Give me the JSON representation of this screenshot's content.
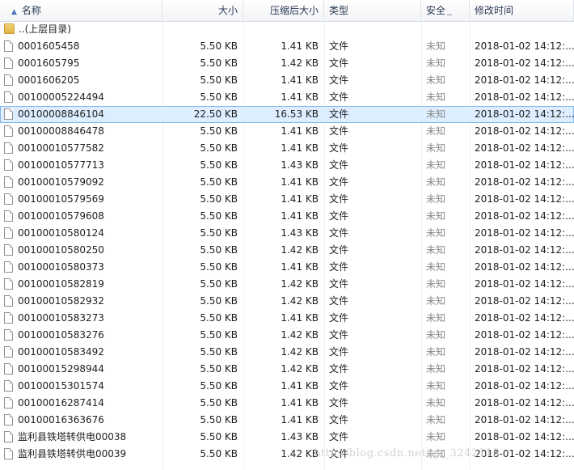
{
  "header": {
    "name": "名称",
    "size": "大小",
    "compressed": "压缩后大小",
    "type": "类型",
    "security": "安全",
    "modified": "修改时间"
  },
  "parent_label": "..(上层目录)",
  "rows": [
    {
      "name": "0001605458",
      "size": "5.50 KB",
      "comp": "1.41 KB",
      "type": "文件",
      "sec": "未知",
      "mod": "2018-01-02 14:12:..."
    },
    {
      "name": "0001605795",
      "size": "5.50 KB",
      "comp": "1.42 KB",
      "type": "文件",
      "sec": "未知",
      "mod": "2018-01-02 14:12:..."
    },
    {
      "name": "0001606205",
      "size": "5.50 KB",
      "comp": "1.41 KB",
      "type": "文件",
      "sec": "未知",
      "mod": "2018-01-02 14:12:..."
    },
    {
      "name": "00100005224494",
      "size": "5.50 KB",
      "comp": "1.41 KB",
      "type": "文件",
      "sec": "未知",
      "mod": "2018-01-02 14:12:..."
    },
    {
      "name": "00100008846104",
      "size": "22.50 KB",
      "comp": "16.53 KB",
      "type": "文件",
      "sec": "未知",
      "mod": "2018-01-02 14:12:...",
      "selected": true
    },
    {
      "name": "00100008846478",
      "size": "5.50 KB",
      "comp": "1.41 KB",
      "type": "文件",
      "sec": "未知",
      "mod": "2018-01-02 14:12:..."
    },
    {
      "name": "00100010577582",
      "size": "5.50 KB",
      "comp": "1.41 KB",
      "type": "文件",
      "sec": "未知",
      "mod": "2018-01-02 14:12:..."
    },
    {
      "name": "00100010577713",
      "size": "5.50 KB",
      "comp": "1.43 KB",
      "type": "文件",
      "sec": "未知",
      "mod": "2018-01-02 14:12:..."
    },
    {
      "name": "00100010579092",
      "size": "5.50 KB",
      "comp": "1.41 KB",
      "type": "文件",
      "sec": "未知",
      "mod": "2018-01-02 14:12:..."
    },
    {
      "name": "00100010579569",
      "size": "5.50 KB",
      "comp": "1.41 KB",
      "type": "文件",
      "sec": "未知",
      "mod": "2018-01-02 14:12:..."
    },
    {
      "name": "00100010579608",
      "size": "5.50 KB",
      "comp": "1.41 KB",
      "type": "文件",
      "sec": "未知",
      "mod": "2018-01-02 14:12:..."
    },
    {
      "name": "00100010580124",
      "size": "5.50 KB",
      "comp": "1.43 KB",
      "type": "文件",
      "sec": "未知",
      "mod": "2018-01-02 14:12:..."
    },
    {
      "name": "00100010580250",
      "size": "5.50 KB",
      "comp": "1.42 KB",
      "type": "文件",
      "sec": "未知",
      "mod": "2018-01-02 14:12:..."
    },
    {
      "name": "00100010580373",
      "size": "5.50 KB",
      "comp": "1.41 KB",
      "type": "文件",
      "sec": "未知",
      "mod": "2018-01-02 14:12:..."
    },
    {
      "name": "00100010582819",
      "size": "5.50 KB",
      "comp": "1.42 KB",
      "type": "文件",
      "sec": "未知",
      "mod": "2018-01-02 14:12:..."
    },
    {
      "name": "00100010582932",
      "size": "5.50 KB",
      "comp": "1.42 KB",
      "type": "文件",
      "sec": "未知",
      "mod": "2018-01-02 14:12:..."
    },
    {
      "name": "00100010583273",
      "size": "5.50 KB",
      "comp": "1.41 KB",
      "type": "文件",
      "sec": "未知",
      "mod": "2018-01-02 14:12:..."
    },
    {
      "name": "00100010583276",
      "size": "5.50 KB",
      "comp": "1.42 KB",
      "type": "文件",
      "sec": "未知",
      "mod": "2018-01-02 14:12:..."
    },
    {
      "name": "00100010583492",
      "size": "5.50 KB",
      "comp": "1.42 KB",
      "type": "文件",
      "sec": "未知",
      "mod": "2018-01-02 14:12:..."
    },
    {
      "name": "00100015298944",
      "size": "5.50 KB",
      "comp": "1.42 KB",
      "type": "文件",
      "sec": "未知",
      "mod": "2018-01-02 14:12:..."
    },
    {
      "name": "00100015301574",
      "size": "5.50 KB",
      "comp": "1.41 KB",
      "type": "文件",
      "sec": "未知",
      "mod": "2018-01-02 14:12:..."
    },
    {
      "name": "00100016287414",
      "size": "5.50 KB",
      "comp": "1.41 KB",
      "type": "文件",
      "sec": "未知",
      "mod": "2018-01-02 14:12:..."
    },
    {
      "name": "00100016363676",
      "size": "5.50 KB",
      "comp": "1.41 KB",
      "type": "文件",
      "sec": "未知",
      "mod": "2018-01-02 14:12:..."
    },
    {
      "name": "监利县铁塔转供电00038",
      "size": "5.50 KB",
      "comp": "1.43 KB",
      "type": "文件",
      "sec": "未知",
      "mod": "2018-01-02 14:12:..."
    },
    {
      "name": "监利县铁塔转供电00039",
      "size": "5.50 KB",
      "comp": "1.42 KB",
      "type": "文件",
      "sec": "未知",
      "mod": "2018-01-02 14:12:..."
    }
  ],
  "watermark": "http://blog.csdn.net/qq_3242115"
}
